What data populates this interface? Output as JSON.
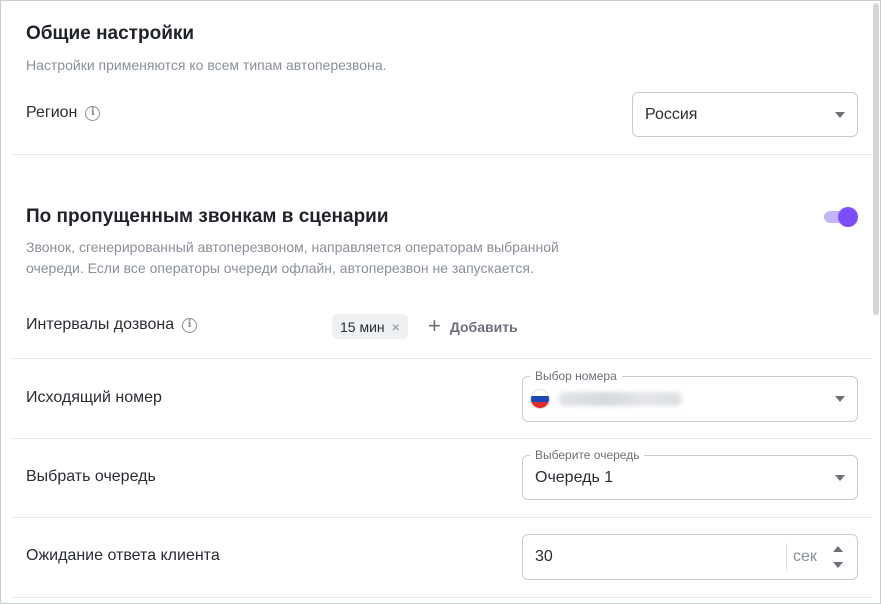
{
  "general": {
    "title": "Общие настройки",
    "description": "Настройки применяются ко всем типам автоперезвона.",
    "region_label": "Регион",
    "region_value": "Россия"
  },
  "missed": {
    "title": "По пропущенным звонкам в сценарии",
    "description_line1": "Звонок, сгенерированный автоперезвоном, направляется операторам выбранной",
    "description_line2": "очереди. Если все операторы очереди офлайн, автоперезвон не запускается.",
    "toggle_on": true,
    "accent_color": "#7c4dff",
    "intervals_label": "Интервалы дозвона",
    "interval_chip": "15 мин",
    "add_label": "Добавить",
    "outgoing_label": "Исходящий номер",
    "outgoing_float_label": "Выбор номера",
    "outgoing_flag": "russia-flag-icon",
    "queue_label": "Выбрать очередь",
    "queue_float_label": "Выберите очередь",
    "queue_value": "Очередь 1",
    "wait_label": "Ожидание ответа клиента",
    "wait_value": "30",
    "wait_unit": "сек"
  }
}
